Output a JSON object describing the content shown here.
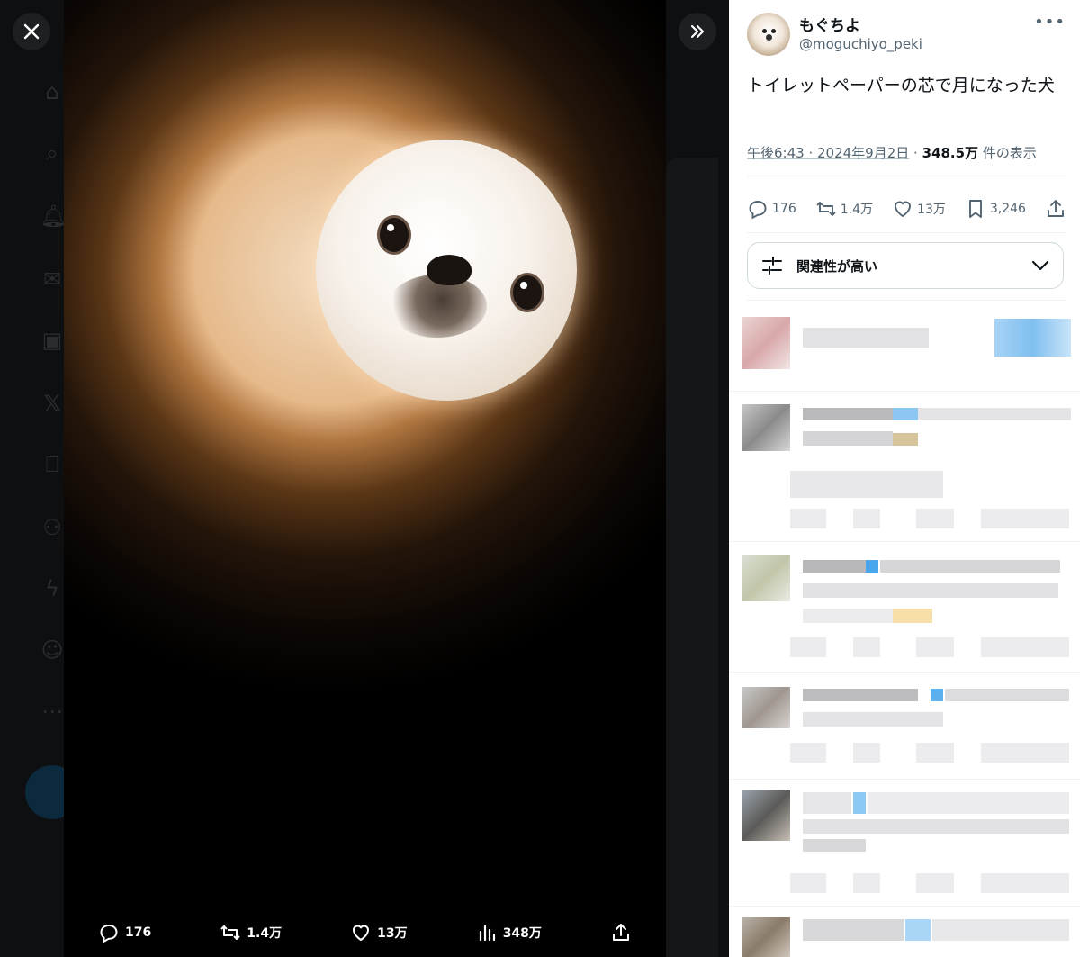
{
  "viewer": {
    "close_label": "Close",
    "expand_label": "Expand",
    "media_actions": {
      "replies": "176",
      "reposts": "1.4万",
      "likes": "13万",
      "views": "348万"
    }
  },
  "tweet": {
    "display_name": "もぐちよ",
    "handle": "@moguchiyo_peki",
    "text": "トイレットペーパーの芯で月になった犬",
    "timestamp": "午後6:43 · 2024年9月2日",
    "separator": "·",
    "views_count": "348.5万",
    "views_label": "件の表示",
    "actions": {
      "replies": "176",
      "reposts": "1.4万",
      "likes": "13万",
      "bookmarks": "3,246"
    },
    "sort_label": "関連性が高い"
  },
  "colors": {
    "accent": "#1d9bf0",
    "text_primary": "#0f1419",
    "text_secondary": "#536471",
    "viewer_bg": "#000000"
  }
}
